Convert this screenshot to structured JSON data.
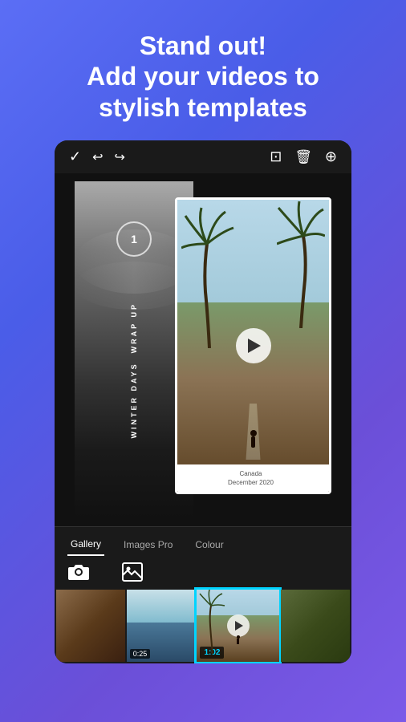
{
  "header": {
    "line1": "Stand out!",
    "line2": "Add your videos to",
    "line3": "stylish templates"
  },
  "toolbar": {
    "check_icon": "✓",
    "undo_icon": "↩",
    "redo_icon": "↪",
    "crop_icon": "⊡",
    "delete_icon": "🗑",
    "more_icon": "⊕"
  },
  "template": {
    "circle_number": "1",
    "vertical_text_line1": "WRAP UP",
    "vertical_text_line2": "WINTER DAYS",
    "caption_line1": "Canada",
    "caption_line2": "December 2020"
  },
  "tabs": {
    "items": [
      {
        "label": "Gallery",
        "active": true
      },
      {
        "label": "Images Pro",
        "active": false
      },
      {
        "label": "Colour",
        "active": false
      }
    ]
  },
  "gallery": {
    "items": [
      {
        "type": "camera",
        "label": "camera"
      },
      {
        "type": "image",
        "label": "image"
      },
      {
        "type": "video",
        "duration": "0:25"
      },
      {
        "type": "video",
        "duration": "1:02",
        "selected": true
      }
    ]
  }
}
